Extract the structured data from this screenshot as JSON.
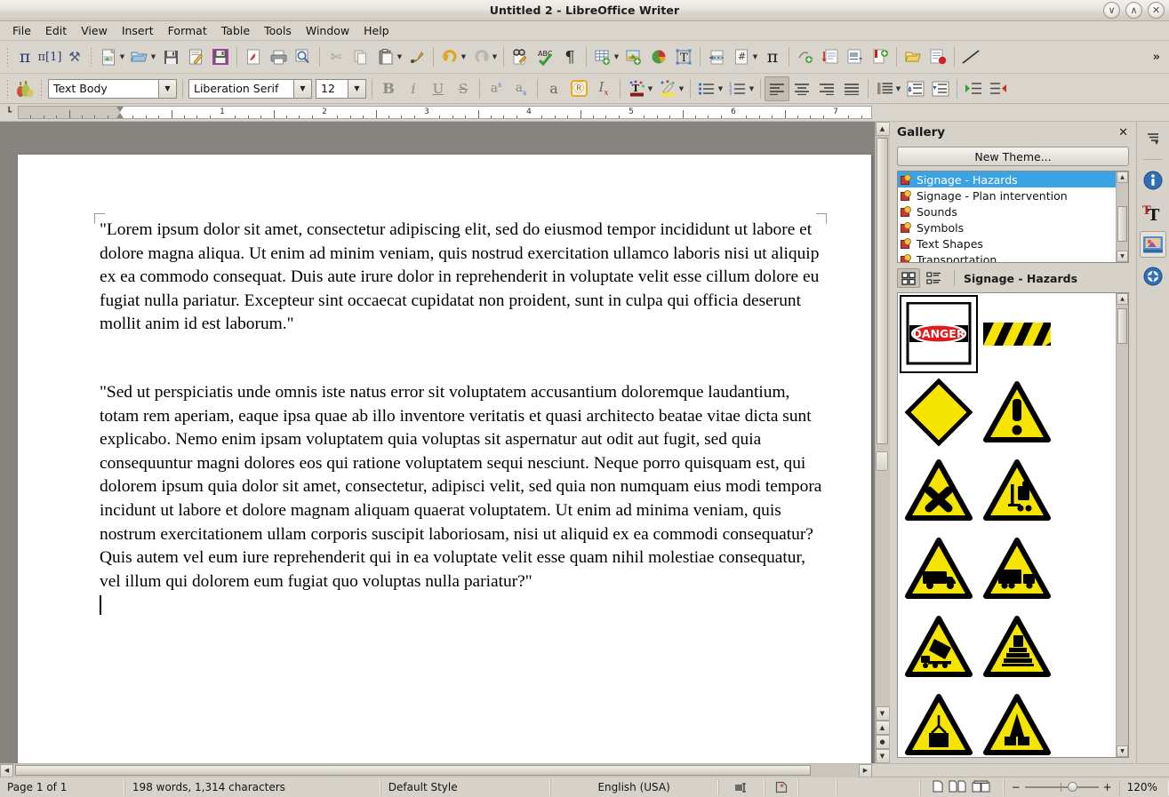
{
  "window": {
    "title": "Untitled 2 - LibreOffice Writer",
    "minimize_label": "∨",
    "maximize_label": "∧",
    "close_label": "✕"
  },
  "menubar": [
    {
      "label": "File"
    },
    {
      "label": "Edit"
    },
    {
      "label": "View"
    },
    {
      "label": "Insert"
    },
    {
      "label": "Format"
    },
    {
      "label": "Table"
    },
    {
      "label": "Tools"
    },
    {
      "label": "Window"
    },
    {
      "label": "Help"
    }
  ],
  "standard_toolbar": {
    "overflow_label": "»",
    "items": [
      {
        "name": "formula-pi-icon",
        "glyph": "π"
      },
      {
        "name": "formula-pi-indexed-icon",
        "glyph": "π[1]"
      },
      {
        "name": "tools-customize-icon",
        "glyph": "⚒"
      },
      {
        "name": "new-document-icon",
        "glyph": "὜E"
      },
      {
        "name": "open-document-icon",
        "glyph": "Ὄ2"
      },
      {
        "name": "save-icon",
        "glyph": "ὋE"
      },
      {
        "name": "edit-file-icon",
        "glyph": "✎"
      },
      {
        "name": "save-as-icon",
        "glyph": "ὋE"
      },
      {
        "name": "export-pdf-icon",
        "glyph": "PDF"
      },
      {
        "name": "print-icon",
        "glyph": "⎙"
      },
      {
        "name": "print-preview-icon",
        "glyph": "ὐD"
      },
      {
        "name": "cut-icon",
        "glyph": "✂"
      },
      {
        "name": "copy-icon",
        "glyph": "⧉"
      },
      {
        "name": "paste-icon",
        "glyph": "ὌB"
      },
      {
        "name": "clone-formatting-icon",
        "glyph": "὘C"
      },
      {
        "name": "undo-icon",
        "glyph": "↶"
      },
      {
        "name": "redo-icon",
        "glyph": "↷"
      },
      {
        "name": "find-replace-icon",
        "glyph": "ὐE"
      },
      {
        "name": "spelling-icon",
        "glyph": "ABC"
      },
      {
        "name": "formatting-marks-icon",
        "glyph": "¶"
      },
      {
        "name": "insert-table-icon",
        "glyph": "▦"
      },
      {
        "name": "insert-image-icon",
        "glyph": "ὛC"
      },
      {
        "name": "insert-chart-icon",
        "glyph": "◕"
      },
      {
        "name": "insert-text-box-icon",
        "glyph": "T"
      },
      {
        "name": "insert-page-break-icon",
        "glyph": "☷"
      },
      {
        "name": "insert-field-icon",
        "glyph": "#"
      },
      {
        "name": "insert-formula-icon",
        "glyph": "π"
      },
      {
        "name": "insert-special-character-icon",
        "glyph": "⊕"
      },
      {
        "name": "insert-footnote-icon",
        "glyph": "↓"
      },
      {
        "name": "insert-endnote-icon",
        "glyph": "↓"
      },
      {
        "name": "insert-bookmark-icon",
        "glyph": "⚑"
      },
      {
        "name": "insert-hyperlink-icon",
        "glyph": "ὑ7"
      },
      {
        "name": "track-changes-icon",
        "glyph": "⛔"
      },
      {
        "name": "insert-line-icon",
        "glyph": "╱"
      }
    ]
  },
  "formatting_toolbar": {
    "gallery_toggle_name": "gallery-icon",
    "paragraph_style": {
      "value": "Text Body",
      "dropdown": "⌄"
    },
    "font_name": {
      "value": "Liberation Serif",
      "dropdown": "⌄"
    },
    "font_size": {
      "value": "12",
      "dropdown": "⌄"
    },
    "buttons": [
      {
        "name": "bold-button",
        "glyph": "B"
      },
      {
        "name": "italic-button",
        "glyph": "i"
      },
      {
        "name": "underline-button",
        "glyph": "U"
      },
      {
        "name": "strikethrough-button",
        "glyph": "S"
      },
      {
        "name": "superscript-button",
        "glyph": "a"
      },
      {
        "name": "subscript-button",
        "glyph": "a"
      },
      {
        "name": "character-highlight-button",
        "glyph": "a"
      },
      {
        "name": "character-shadow-button",
        "glyph": "ⓞ"
      },
      {
        "name": "clear-formatting-button",
        "glyph": "Iₓ"
      },
      {
        "name": "font-color-button",
        "glyph": "T"
      },
      {
        "name": "highlighting-color-button",
        "glyph": "✒"
      },
      {
        "name": "unordered-list-button",
        "glyph": "☰"
      },
      {
        "name": "ordered-list-button",
        "glyph": "≡"
      },
      {
        "name": "align-left-button",
        "glyph": "≡"
      },
      {
        "name": "align-center-button",
        "glyph": "≡"
      },
      {
        "name": "align-right-button",
        "glyph": "≡"
      },
      {
        "name": "justified-button",
        "glyph": "≡"
      },
      {
        "name": "line-spacing-button",
        "glyph": "≣"
      },
      {
        "name": "increase-paragraph-spacing-button",
        "glyph": "⤒"
      },
      {
        "name": "decrease-paragraph-spacing-button",
        "glyph": "⤓"
      },
      {
        "name": "increase-indent-button",
        "glyph": "▶"
      },
      {
        "name": "decrease-indent-button",
        "glyph": "◀"
      }
    ]
  },
  "ruler": {
    "unit_numbers": [
      "1",
      "2",
      "3",
      "4",
      "5",
      "6",
      "7"
    ],
    "corner_icon": "┗"
  },
  "document": {
    "paragraphs": [
      "\"Lorem ipsum dolor sit amet, consectetur adipiscing elit, sed do eiusmod tempor incididunt ut labore et dolore magna aliqua. Ut enim ad minim veniam, quis nostrud exercitation ullamco laboris nisi ut aliquip ex ea commodo consequat. Duis aute irure dolor in reprehenderit in voluptate velit esse cillum dolore eu fugiat nulla pariatur. Excepteur sint occaecat cupidatat non proident, sunt in culpa qui officia deserunt mollit anim id est laborum.\"",
      "\"Sed ut perspiciatis unde omnis iste natus error sit voluptatem accusantium doloremque laudantium, totam rem aperiam, eaque ipsa quae ab illo inventore veritatis et quasi architecto beatae vitae dicta sunt explicabo. Nemo enim ipsam voluptatem quia voluptas sit aspernatur aut odit aut fugit, sed quia consequuntur magni dolores eos qui ratione voluptatem sequi nesciunt. Neque porro quisquam est, qui dolorem ipsum quia dolor sit amet, consectetur, adipisci velit, sed quia non numquam eius modi tempora incidunt ut labore et dolore magnam aliquam quaerat voluptatem. Ut enim ad minima veniam, quis nostrum exercitationem ullam corporis suscipit laboriosam, nisi ut aliquid ex ea commodi consequatur? Quis autem vel eum iure reprehenderit qui in ea voluptate velit esse quam nihil molestiae consequatur, vel illum qui dolorem eum fugiat quo voluptas nulla pariatur?\""
    ]
  },
  "gallery": {
    "panel_title": "Gallery",
    "close_label": "✕",
    "new_theme_label": "New Theme...",
    "themes": [
      {
        "label": "Signage - Hazards",
        "selected": true
      },
      {
        "label": "Signage - Plan intervention",
        "selected": false
      },
      {
        "label": "Sounds",
        "selected": false
      },
      {
        "label": "Symbols",
        "selected": false
      },
      {
        "label": "Text Shapes",
        "selected": false
      },
      {
        "label": "Transportation",
        "selected": false
      }
    ],
    "view_icon_label": "icon-view-icon",
    "view_list_label": "list-view-icon",
    "current_theme": "Signage - Hazards",
    "items": [
      {
        "name": "danger-sign",
        "kind": "danger",
        "selected": true
      },
      {
        "name": "hazard-stripes",
        "kind": "stripes",
        "selected": false
      },
      {
        "name": "yellow-diamond-sign",
        "kind": "diamond",
        "selected": false
      },
      {
        "name": "general-warning-sign",
        "kind": "exclamation",
        "selected": false
      },
      {
        "name": "harmful-substance-sign",
        "kind": "cross",
        "selected": false
      },
      {
        "name": "forklift-warning-sign",
        "kind": "forklift",
        "selected": false
      },
      {
        "name": "truck-warning-sign",
        "kind": "truck",
        "selected": false
      },
      {
        "name": "articulated-truck-sign",
        "kind": "truck2",
        "selected": false
      },
      {
        "name": "tipping-truck-sign",
        "kind": "tipper",
        "selected": false
      },
      {
        "name": "falling-load-sign",
        "kind": "stack",
        "selected": false
      },
      {
        "name": "suspended-load-sign",
        "kind": "crane",
        "selected": false
      },
      {
        "name": "crushing-hazard-sign",
        "kind": "crush",
        "selected": false
      }
    ]
  },
  "sidebar_rail": [
    {
      "name": "sidebar-settings-icon",
      "label": "≡",
      "active": false
    },
    {
      "name": "sidebar-properties-icon",
      "label": "i",
      "active": false
    },
    {
      "name": "sidebar-styles-icon",
      "label": "T",
      "active": false
    },
    {
      "name": "sidebar-gallery-icon",
      "label": "ὛC",
      "active": true
    },
    {
      "name": "sidebar-navigator-icon",
      "label": "☸",
      "active": false
    }
  ],
  "statusbar": {
    "page": "Page 1 of 1",
    "word_count": "198 words, 1,314 characters",
    "page_style": "Default Style",
    "language": "English (USA)",
    "selection_mode_icon": "selection-mode-icon",
    "unsaved_changes_icon": "document-modified-icon",
    "view_single_page_icon": "single-page-view-icon",
    "view_multi_page_icon": "multi-page-view-icon",
    "view_book_icon": "book-view-icon",
    "zoom_out_label": "−",
    "zoom_in_label": "+",
    "zoom_value": "120%"
  }
}
